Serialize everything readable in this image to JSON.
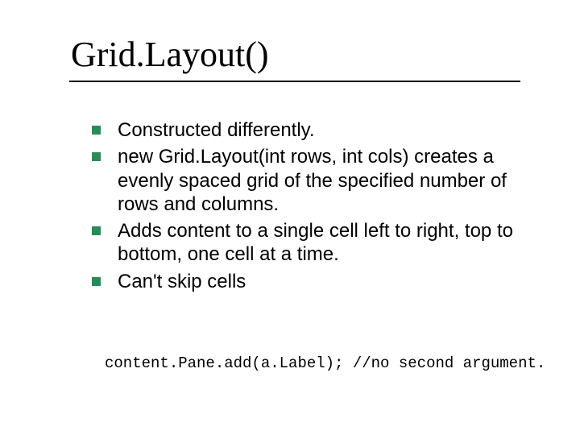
{
  "slide": {
    "title": "Grid.Layout()",
    "bullets": [
      "Constructed differently.",
      "new Grid.Layout(int rows, int cols) creates a evenly spaced grid of the specified number of rows and columns.",
      "Adds content to a single cell left to right, top to bottom, one cell at a time.",
      "Can't skip cells"
    ],
    "code": "content.Pane.add(a.Label); //no second argument."
  }
}
